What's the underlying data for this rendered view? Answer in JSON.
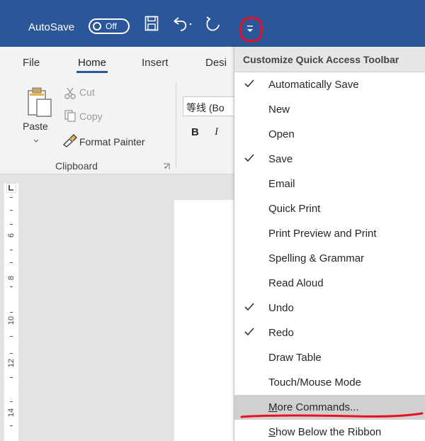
{
  "titlebar": {
    "autosave_label": "AutoSave",
    "autosave_toggle": "Off",
    "background": "#2b579a",
    "annotation_color": "#e81123"
  },
  "tabs": [
    {
      "label": "File",
      "active": false
    },
    {
      "label": "Home",
      "active": true
    },
    {
      "label": "Insert",
      "active": false
    },
    {
      "label": "Desi",
      "active": false
    }
  ],
  "ribbon": {
    "paste": "Paste",
    "cut": "Cut",
    "copy": "Copy",
    "format_painter": "Format Painter",
    "font_name": "等线 (Bo",
    "bold": "B",
    "italic": "I",
    "clipboard_group": "Clipboard"
  },
  "ruler": {
    "corner": "L",
    "numbers": [
      "6",
      "8",
      "10",
      "12",
      "14"
    ]
  },
  "menu": {
    "header": "Customize Quick Access Toolbar",
    "items": [
      {
        "label": "Automatically Save",
        "checked": true
      },
      {
        "label": "New",
        "checked": false
      },
      {
        "label": "Open",
        "checked": false
      },
      {
        "label": "Save",
        "checked": true
      },
      {
        "label": "Email",
        "checked": false
      },
      {
        "label": "Quick Print",
        "checked": false
      },
      {
        "label": "Print Preview and Print",
        "checked": false
      },
      {
        "label": "Spelling & Grammar",
        "checked": false
      },
      {
        "label": "Read Aloud",
        "checked": false
      },
      {
        "label": "Undo",
        "checked": true
      },
      {
        "label": "Redo",
        "checked": true
      },
      {
        "label": "Draw Table",
        "checked": false
      },
      {
        "label": "Touch/Mouse Mode",
        "checked": false
      },
      {
        "label": "More Commands...",
        "checked": false,
        "highlighted": true
      },
      {
        "label": "Show Below the Ribbon",
        "checked": false
      }
    ]
  }
}
